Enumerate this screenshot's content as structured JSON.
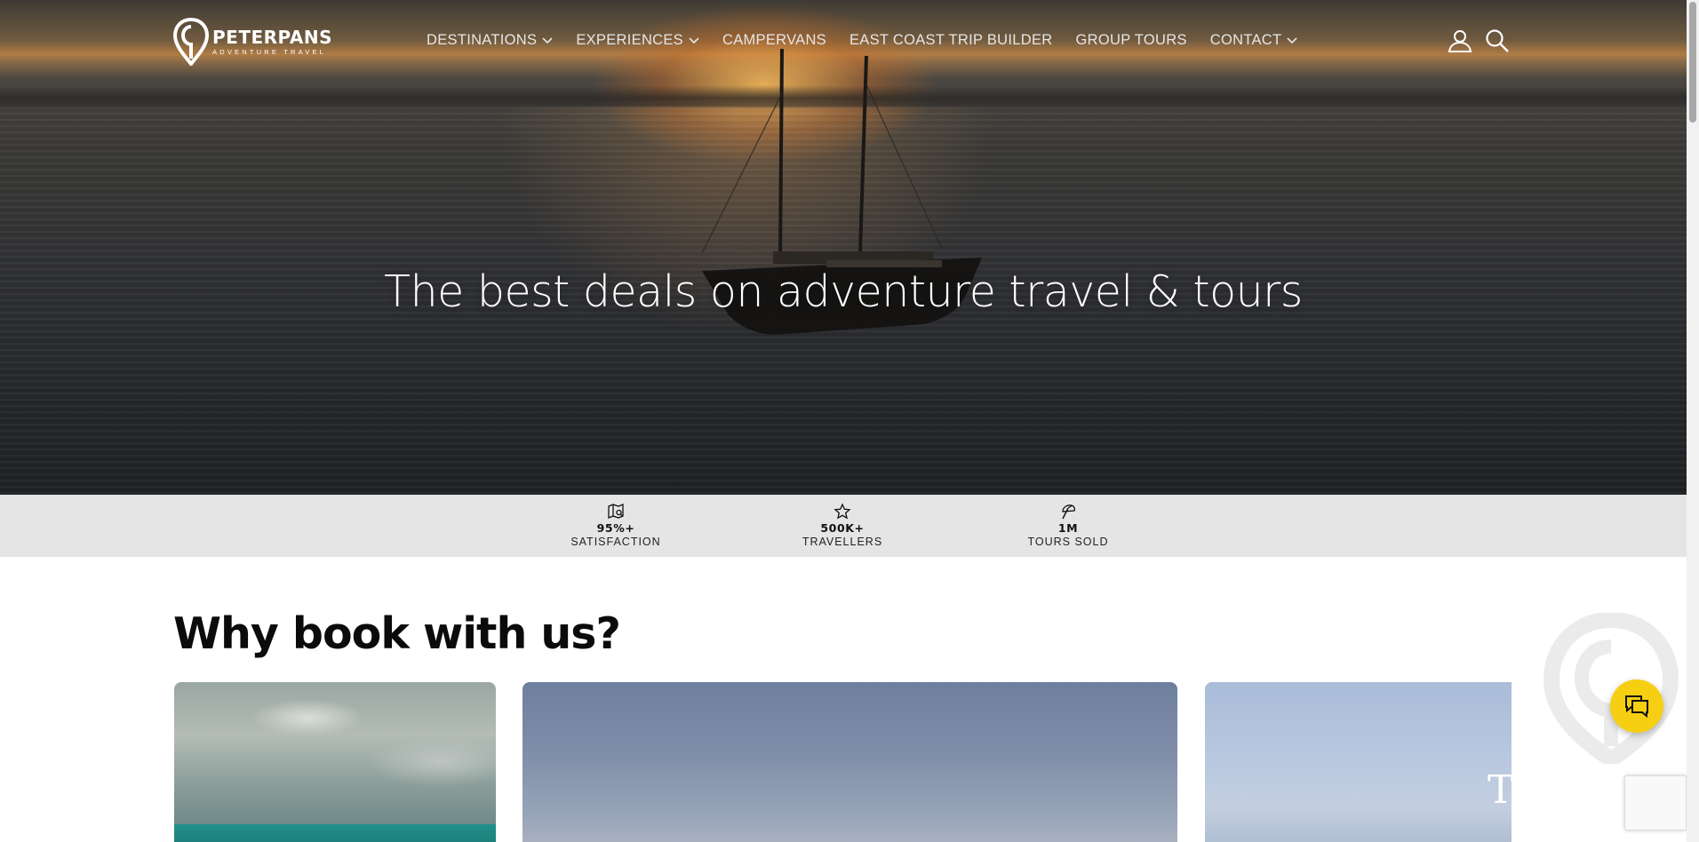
{
  "brand": {
    "name": "PETERPANS",
    "tagline": "ADVENTURE TRAVEL",
    "accent_color": "#f7cf12"
  },
  "nav": {
    "items": [
      {
        "label": "DESTINATIONS",
        "has_dropdown": true
      },
      {
        "label": "EXPERIENCES",
        "has_dropdown": true
      },
      {
        "label": "CAMPERVANS",
        "has_dropdown": false
      },
      {
        "label": "EAST COAST TRIP BUILDER",
        "has_dropdown": false
      },
      {
        "label": "GROUP TOURS",
        "has_dropdown": false
      },
      {
        "label": "CONTACT",
        "has_dropdown": true
      }
    ],
    "icons": [
      "user-icon",
      "search-icon"
    ]
  },
  "hero": {
    "title": "The best deals on adventure travel & tours"
  },
  "stats": [
    {
      "icon": "map-search-icon",
      "value": "95%+",
      "label": "SATISFACTION"
    },
    {
      "icon": "star-icon",
      "value": "500K+",
      "label": "TRAVELLERS"
    },
    {
      "icon": "beach-umbrella-icon",
      "value": "1M",
      "label": "TOURS SOLD"
    }
  ],
  "why": {
    "title": "Why book with us?",
    "card3_text": "T"
  },
  "chat": {
    "icon": "chat-bubbles-icon"
  }
}
